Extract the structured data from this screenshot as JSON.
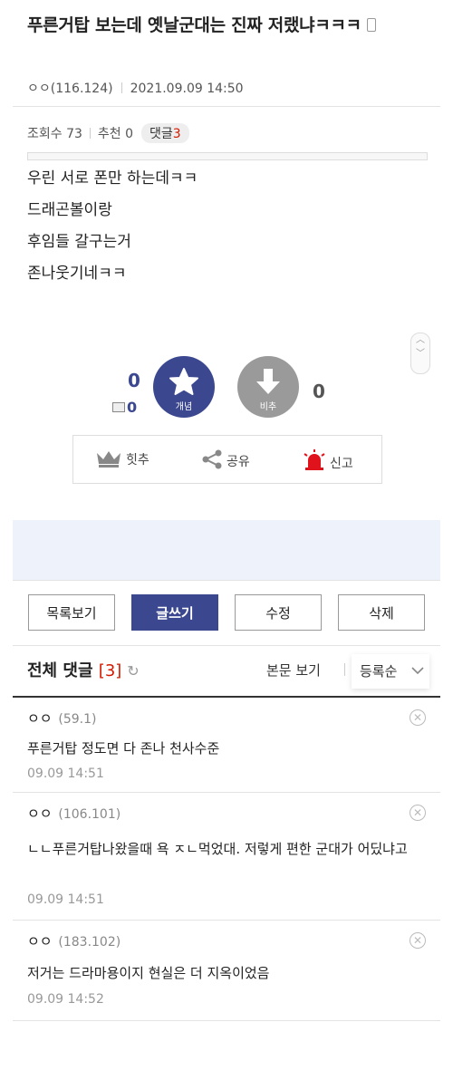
{
  "post": {
    "title": "푸른거탑 보는데 옛날군대는 진짜 저랬냐ㅋㅋㅋ",
    "author": "ㅇㅇ",
    "author_ip": "(116.124)",
    "date": "2021.09.09 14:50",
    "views_label": "조회수",
    "views": "73",
    "recommend_label": "추천",
    "recommend": "0",
    "comments_label": "댓글",
    "comments": "3",
    "body_lines": [
      "우린 서로 폰만 하는데ㅋㅋ",
      "드래곤볼이랑",
      "후임들 갈구는거",
      "존나웃기네ㅋㅋ"
    ]
  },
  "vote": {
    "up_count": "0",
    "fixed_count": "0",
    "up_label": "개념",
    "down_label": "비추",
    "down_count": "0"
  },
  "actions": {
    "hit": "힛추",
    "share": "공유",
    "report": "신고"
  },
  "buttons": {
    "list": "목록보기",
    "write": "글쓰기",
    "edit": "수정",
    "delete": "삭제"
  },
  "comments_section": {
    "title": "전체 댓글",
    "count": "[3]",
    "view_body": "본문 보기",
    "sort": "등록순"
  },
  "comments": [
    {
      "nick": "ㅇㅇ",
      "ip": "(59.1)",
      "text": "푸른거탑 정도면 다 존나 천사수준",
      "time": "09.09 14:51"
    },
    {
      "nick": "ㅇㅇ",
      "ip": "(106.101)",
      "text": "ㄴㄴ푸른거탑나왔을때 욕 ㅈㄴ먹었대. 저렇게 편한 군대가 어딨냐고",
      "time": "09.09 14:51"
    },
    {
      "nick": "ㅇㅇ",
      "ip": "(183.102)",
      "text": "저거는 드라마용이지 현실은 더 지옥이었음",
      "time": "09.09 14:52"
    }
  ],
  "colors": {
    "accent": "#3b4890",
    "red": "#d31900",
    "grey": "#9a9a9a"
  }
}
